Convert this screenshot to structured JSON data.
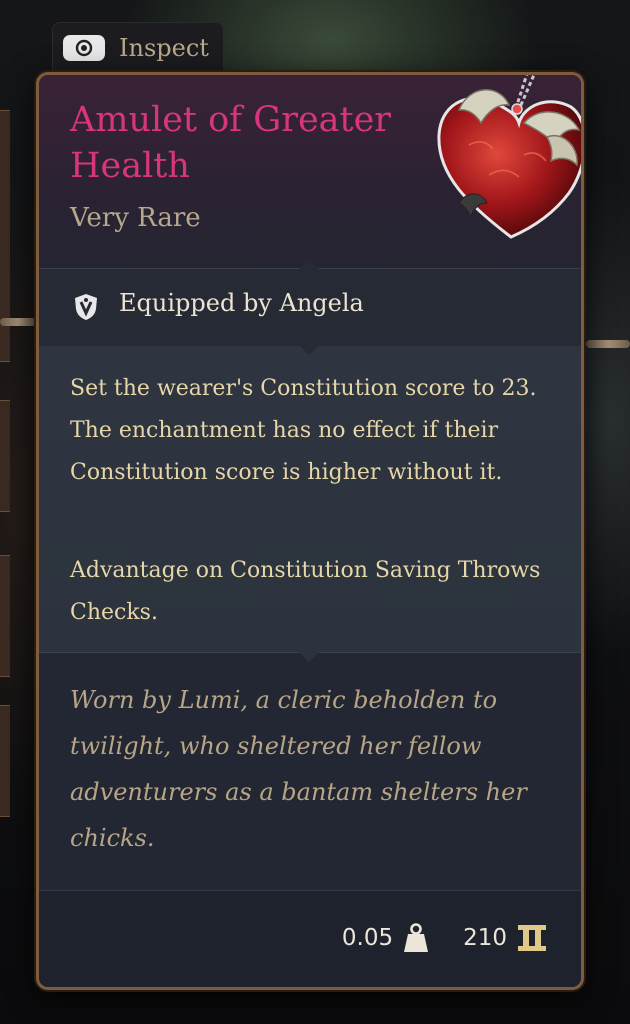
{
  "inspect": {
    "label": "Inspect",
    "key_icon": "mouse-key-icon"
  },
  "item": {
    "name": "Amulet of Greater Health",
    "rarity": "Very Rare",
    "image_icon": "heart-amulet-icon",
    "equipped_by": "Equipped by Angela",
    "description": [
      "Set the wearer's Constitution score to 23. The enchantment has no effect if their Constitution score is higher without it.",
      "Advantage on Constitution Saving Throws Checks."
    ],
    "lore": "Worn by Lumi, a cleric beholden to twilight, who sheltered her fellow adventurers as a bantam shelters her chicks.",
    "weight": "0.05",
    "price": "210"
  },
  "colors": {
    "name": "#d8357f",
    "rarity": "#b7a78c",
    "description": "#e6d6a8",
    "lore": "#b8a585",
    "border": "#7e5d3f",
    "gold": "#e0c888"
  }
}
